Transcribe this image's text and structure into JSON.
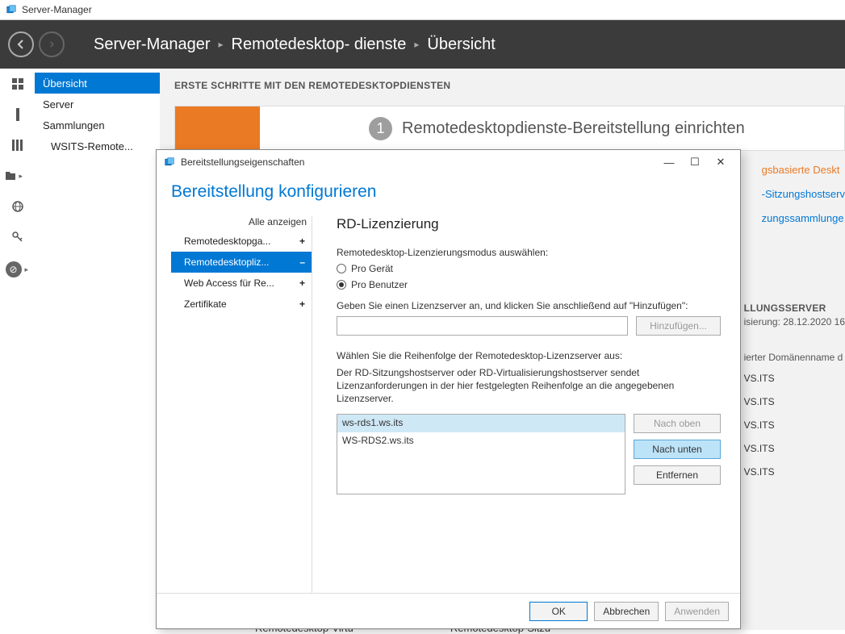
{
  "titlebar": {
    "app_name": "Server-Manager"
  },
  "header": {
    "crumb1": "Server-Manager",
    "crumb2": "Remotedesktop- dienste",
    "crumb3": "Übersicht"
  },
  "sidenav": {
    "items": [
      {
        "label": "Übersicht",
        "selected": true
      },
      {
        "label": "Server",
        "selected": false
      },
      {
        "label": "Sammlungen",
        "selected": false
      },
      {
        "label": "WSITS-Remote...",
        "selected": false,
        "child": true
      }
    ]
  },
  "content": {
    "section_title": "ERSTE SCHRITTE MIT DEN REMOTEDESKTOPDIENSTEN",
    "step_number": "1",
    "wizard_text": "Remotedesktopdienste-Bereitstellung einrichten",
    "partial_link_1": "gsbasierte Deskt",
    "partial_link_2": "-Sitzungshostserv",
    "partial_link_3": "zungssammlunge",
    "panel_header": "LLUNGSSERVER",
    "panel_tasks": "isierung: 28.12.2020 16",
    "panel_label": "ierter Domänenname d",
    "panel_vals": [
      "VS.ITS",
      "VS.ITS",
      "VS.ITS",
      "VS.ITS",
      "VS.ITS"
    ],
    "bottom_1": "Remotedesktop-Virtu",
    "bottom_2": "Remotedesktop-Sitzu"
  },
  "dialog": {
    "title": "Bereitstellungseigenschaften",
    "heading": "Bereitstellung konfigurieren",
    "show_all": "Alle anzeigen",
    "categories": [
      {
        "label": "Remotedesktopga...",
        "exp": "+",
        "selected": false
      },
      {
        "label": "Remotedesktopliz...",
        "exp": "–",
        "selected": true
      },
      {
        "label": "Web Access für Re...",
        "exp": "+",
        "selected": false
      },
      {
        "label": "Zertifikate",
        "exp": "+",
        "selected": false
      }
    ],
    "right": {
      "section_title": "RD-Lizenzierung",
      "mode_label": "Remotedesktop-Lizenzierungsmodus auswählen:",
      "radio_device": "Pro Gerät",
      "radio_user": "Pro Benutzer",
      "server_label": "Geben Sie einen Lizenzserver an, und klicken Sie anschließend auf \"Hinzufügen\":",
      "add_btn": "Hinzufügen...",
      "order_label": "Wählen Sie die Reihenfolge der Remotedesktop-Lizenzserver aus:",
      "order_desc": "Der RD-Sitzungshostserver oder RD-Virtualisierungshostserver sendet Lizenzanforderungen in der hier festgelegten Reihenfolge an die angegebenen Lizenzserver.",
      "servers": [
        "ws-rds1.ws.its",
        "WS-RDS2.ws.its"
      ],
      "btn_up": "Nach oben",
      "btn_down": "Nach unten",
      "btn_remove": "Entfernen"
    },
    "footer": {
      "ok": "OK",
      "cancel": "Abbrechen",
      "apply": "Anwenden"
    }
  }
}
